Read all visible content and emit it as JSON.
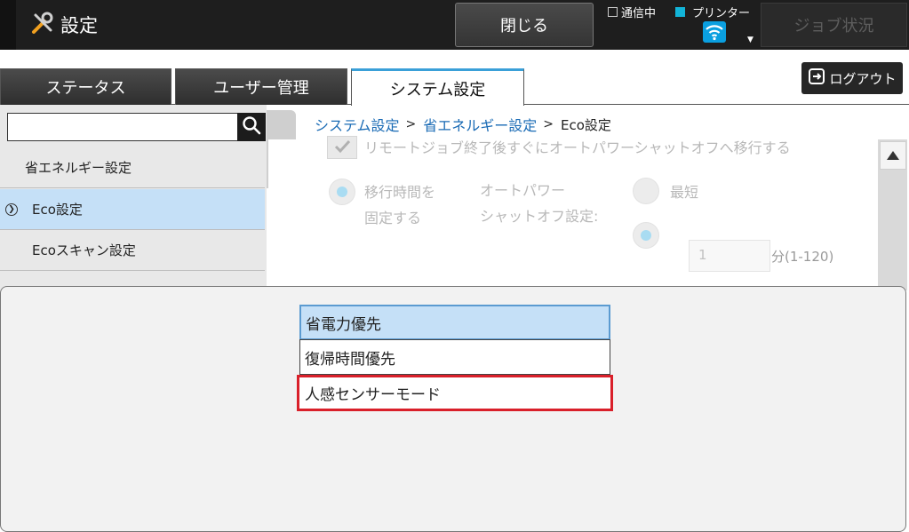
{
  "header": {
    "title": "設定",
    "close_label": "閉じる",
    "comm_status": "通信中",
    "printer_label": "プリンター",
    "job_status_label": "ジョブ状況"
  },
  "tabs": [
    {
      "label": "ステータス"
    },
    {
      "label": "ユーザー管理"
    },
    {
      "label": "システム設定"
    }
  ],
  "logout_label": "ログアウト",
  "search": {
    "value": "",
    "placeholder": ""
  },
  "sidebar": {
    "items": [
      {
        "label": "省エネルギー設定"
      },
      {
        "label": "Eco設定"
      },
      {
        "label": "Ecoスキャン設定"
      }
    ]
  },
  "breadcrumb": {
    "items": [
      "システム設定",
      "省エネルギー設定",
      "Eco設定"
    ],
    "separator": ">"
  },
  "content": {
    "remote_job_label": "リモートジョブ終了後すぐにオートパワーシャットオフへ移行する",
    "fixed_time_line1": "移行時間を",
    "fixed_time_line2": "固定する",
    "auto_power_line1": "オートパワー",
    "auto_power_line2": "シャットオフ設定:",
    "shortest_label": "最短",
    "minutes_value": "1",
    "minutes_unit": "分(1-120)"
  },
  "dropdown": {
    "options": [
      {
        "label": "省電力優先"
      },
      {
        "label": "復帰時間優先"
      },
      {
        "label": "人感センサーモード"
      }
    ]
  },
  "colors": {
    "accent": "#3aa0d8",
    "selected_bg": "#c5e0f7",
    "highlight": "#d9202a",
    "link": "#1a6bb5"
  }
}
